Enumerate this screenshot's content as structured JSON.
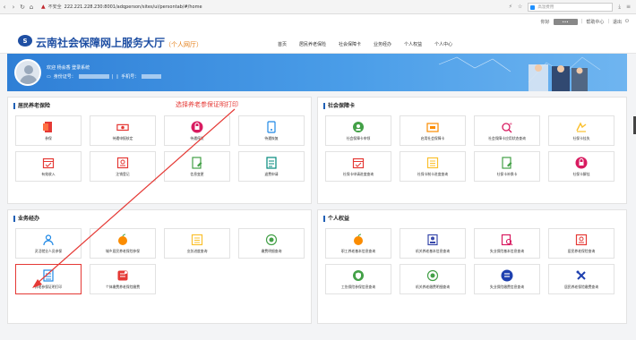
{
  "browser": {
    "url": "222.221.228.230:8001/adqperson/sites/ui/persontab/#/home",
    "secure_label": "不安全",
    "search_placeholder": "高温费用"
  },
  "topbar": {
    "suffix": "你好",
    "links": [
      "帮助中心",
      "退出"
    ]
  },
  "header": {
    "logo_letter": "S",
    "title": "云南社会保障网上服务大厅",
    "subtitle": "（个人网厅）",
    "nav": [
      "首页",
      "居民养老保险",
      "社会保障卡",
      "业务经办",
      "个人权益",
      "个人中心"
    ]
  },
  "banner": {
    "welcome": "欢迎 杨会香 登录系统",
    "id_label": "身份证号：",
    "phone_label": "手机号："
  },
  "annotation": "选择养老参保证明打印",
  "sections": [
    {
      "title": "居民养老保险",
      "tiles": [
        {
          "label": "参保",
          "icon": "form-icon",
          "color": "#e53935"
        },
        {
          "label": "待遇申报核定",
          "icon": "cash-icon",
          "color": "#e53935"
        },
        {
          "label": "待遇停发",
          "icon": "lock-icon",
          "color": "#d81b60"
        },
        {
          "label": "待遇恢复",
          "icon": "phone-doc-icon",
          "color": "#1e88e5"
        },
        {
          "label": "有效收入",
          "icon": "calendar-icon",
          "color": "#e53935"
        },
        {
          "label": "注销登记",
          "icon": "id-card-icon",
          "color": "#e53935"
        },
        {
          "label": "信息变更",
          "icon": "edit-doc-icon",
          "color": "#43a047"
        },
        {
          "label": "退费申请",
          "icon": "doc-list-icon",
          "color": "#00897b"
        }
      ]
    },
    {
      "title": "社会保障卡",
      "tiles": [
        {
          "label": "社会保障卡申领",
          "icon": "badge-icon",
          "color": "#43a047"
        },
        {
          "label": "启用社会保障卡",
          "icon": "card-icon",
          "color": "#fb8c00"
        },
        {
          "label": "社会保障卡应用状态查询",
          "icon": "search-plus-icon",
          "color": "#d81b60"
        },
        {
          "label": "社保卡挂失",
          "icon": "hand-icon",
          "color": "#fbc02d"
        },
        {
          "label": "社保卡申请进度查询",
          "icon": "calendar-icon",
          "color": "#e53935"
        },
        {
          "label": "社保卡制卡进度查询",
          "icon": "list-icon",
          "color": "#fbc02d"
        },
        {
          "label": "社保卡补换卡",
          "icon": "edit-doc-icon",
          "color": "#43a047"
        },
        {
          "label": "社保卡解挂",
          "icon": "lock-icon",
          "color": "#d81b60"
        }
      ]
    },
    {
      "title": "业务经办",
      "tiles": [
        {
          "label": "灵活就业人员参保",
          "icon": "person-icon",
          "color": "#1e88e5"
        },
        {
          "label": "城乡居民养老保险参保",
          "icon": "apple-icon",
          "color": "#fb8c00"
        },
        {
          "label": "业务进度查询",
          "icon": "list-icon",
          "color": "#fbc02d"
        },
        {
          "label": "缴费明细查询",
          "icon": "coin-icon",
          "color": "#43a047"
        },
        {
          "label": "养老参保证明打印",
          "icon": "print-doc-icon",
          "color": "#1e88e5",
          "highlight": true
        },
        {
          "label": "个体缴费养老保险缴费",
          "icon": "doc-print-icon",
          "color": "#e53935"
        }
      ]
    },
    {
      "title": "个人权益",
      "tiles": [
        {
          "label": "职工养老基本信息查询",
          "icon": "apple-icon",
          "color": "#fb8c00"
        },
        {
          "label": "机关养老基本信息查询",
          "icon": "person-card-icon",
          "color": "#3949ab"
        },
        {
          "label": "失业保险基本信息查询",
          "icon": "doc-search-icon",
          "color": "#d81b60"
        },
        {
          "label": "居民养老保险查询",
          "icon": "id-card-icon",
          "color": "#e53935"
        },
        {
          "label": "工伤保险参保信息查询",
          "icon": "shield-icon",
          "color": "#43a047"
        },
        {
          "label": "机关养老缴费明细查询",
          "icon": "coin-icon",
          "color": "#43a047"
        },
        {
          "label": "失业保险缴费信息查询",
          "icon": "record-icon",
          "color": "#1e40af"
        },
        {
          "label": "居民养老保险缴费查询",
          "icon": "tools-icon",
          "color": "#1e40af"
        }
      ]
    }
  ]
}
